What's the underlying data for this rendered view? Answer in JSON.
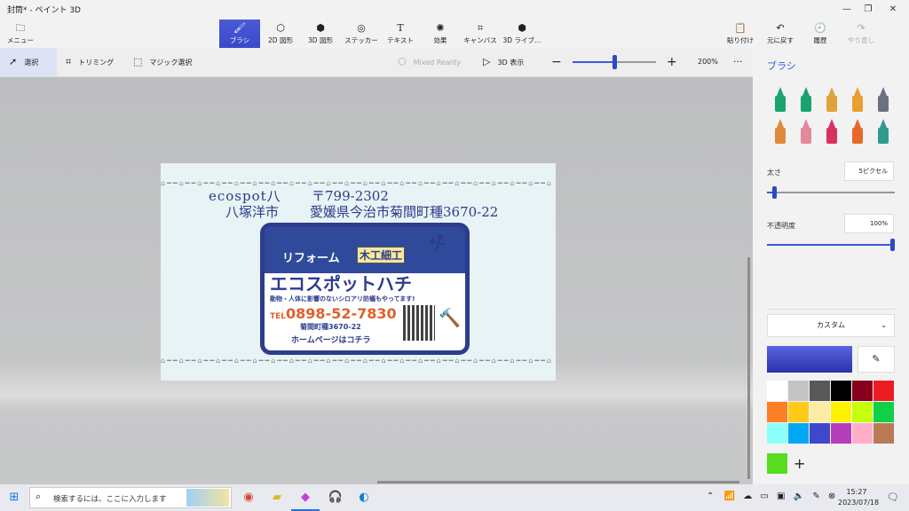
{
  "window": {
    "title": "封筒* - ペイント 3D",
    "min": "—",
    "restore": "❐",
    "close": "✕"
  },
  "toolbar": {
    "menu": "メニュー",
    "tools": [
      {
        "label": "ブラシ",
        "icon": "brush-icon",
        "active": true
      },
      {
        "label": "2D 図形",
        "icon": "shapes-2d-icon"
      },
      {
        "label": "3D 図形",
        "icon": "shapes-3d-icon"
      },
      {
        "label": "ステッカー",
        "icon": "sticker-icon"
      },
      {
        "label": "テキスト",
        "icon": "text-icon"
      },
      {
        "label": "効果",
        "icon": "effects-icon"
      },
      {
        "label": "キャンバス",
        "icon": "canvas-icon"
      },
      {
        "label": "3D ライブ…",
        "icon": "library-3d-icon"
      }
    ],
    "right": [
      {
        "label": "貼り付け",
        "icon": "paste-icon"
      },
      {
        "label": "元に戻す",
        "icon": "undo-icon"
      },
      {
        "label": "履歴",
        "icon": "history-icon"
      },
      {
        "label": "やり直し",
        "icon": "redo-icon",
        "disabled": true
      }
    ]
  },
  "subbar": {
    "select": "選択",
    "trim": "トリミング",
    "magic": "マジック選択",
    "mixed": "Mixed Reality",
    "view3d": "3D 表示",
    "zoom": "200%",
    "zoom_level": 0.5,
    "more": "···"
  },
  "card": {
    "line1_left": "ecospot八",
    "line1_right": "〒799-2302",
    "line2_left": "八塚洋市",
    "line2_right": "愛媛県今治市菊間町種3670-22",
    "ad_title1": "リフォーム",
    "ad_tag": "木工細工",
    "ad_title2": "エコスポットハチ",
    "ad_desc": "動物・人体に影響のないシロアリ防蟻もやってます!",
    "ad_tel_prefix": "TEL",
    "ad_tel": "0898-52-7830",
    "ad_addr": "菊間町種3670-22",
    "ad_home": "ホームページはコチラ"
  },
  "panel": {
    "title": "ブラシ",
    "brushes": [
      {
        "name": "marker-brush",
        "color": "#1aa36f"
      },
      {
        "name": "calligraphy-pen-brush",
        "color": "#1aa36f"
      },
      {
        "name": "oil-brush",
        "color": "#e0a33c"
      },
      {
        "name": "watercolor-brush",
        "color": "#e8a030"
      },
      {
        "name": "pixel-pen-brush",
        "color": "#6a7280"
      },
      {
        "name": "pencil-brush",
        "color": "#e0893b"
      },
      {
        "name": "eraser-brush",
        "color": "#e08a9a"
      },
      {
        "name": "crayon-brush",
        "color": "#d8325a"
      },
      {
        "name": "spray-can-brush",
        "color": "#e8682a"
      },
      {
        "name": "fill-brush",
        "color": "#2f9c8c"
      }
    ],
    "thickness_label": "太さ",
    "thickness_value": "5ピクセル",
    "opacity_label": "不透明度",
    "opacity_value": "100%",
    "color_mode": "カスタム",
    "current_color": "#3c45c8",
    "palette": [
      "#ffffff",
      "#c3c3c3",
      "#585858",
      "#000000",
      "#88001b",
      "#ec1c24",
      "#ff7f27",
      "#ffca18",
      "#fdeca6",
      "#fff200",
      "#c4ff0e",
      "#0ed145",
      "#8cfffb",
      "#00a8f3",
      "#3f48cc",
      "#b83dba",
      "#ffaec8",
      "#b97a56"
    ],
    "custom_swatch": "#55dd1e",
    "add": "+"
  },
  "taskbar": {
    "search_placeholder": "検索するには、ここに入力します",
    "time": "15:27",
    "date": "2023/07/18"
  }
}
